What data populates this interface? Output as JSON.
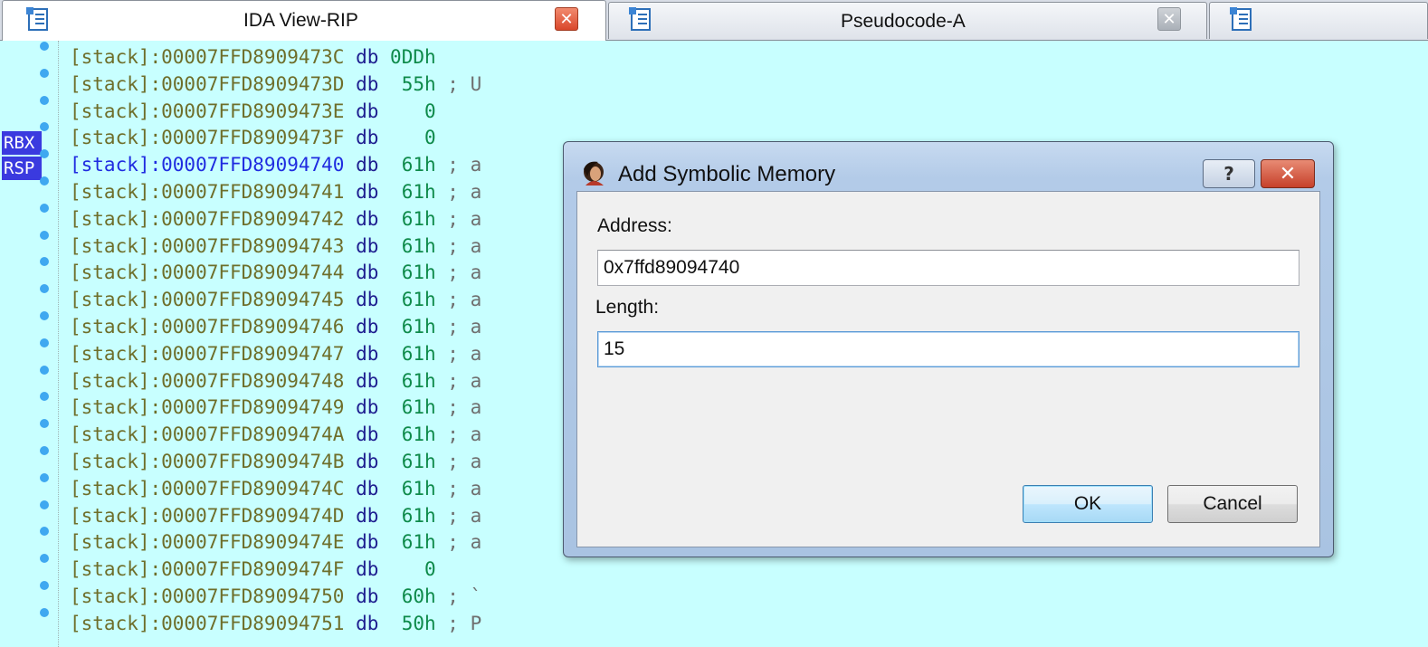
{
  "tabs": [
    {
      "label": "IDA View-RIP",
      "icon": "disassembly-view-icon",
      "active": true,
      "close_color": "red"
    },
    {
      "label": "Pseudocode-A",
      "icon": "pseudocode-view-icon",
      "active": false,
      "close_color": "grey"
    },
    {
      "label": "",
      "icon": "view-icon",
      "active": false
    }
  ],
  "registers": [
    "RBX",
    "RSP"
  ],
  "listing": [
    {
      "seg": "[stack]:00007FFD8909473C",
      "mn": "db",
      "val": "0DDh",
      "cmt": ""
    },
    {
      "seg": "[stack]:00007FFD8909473D",
      "mn": "db",
      "val": " 55h",
      "cmt": "; U"
    },
    {
      "seg": "[stack]:00007FFD8909473E",
      "mn": "db",
      "val": "   0",
      "cmt": ""
    },
    {
      "seg": "[stack]:00007FFD8909473F",
      "mn": "db",
      "val": "   0",
      "cmt": ""
    },
    {
      "seg": "[stack]:00007FFD89094740",
      "mn": "db",
      "val": " 61h",
      "cmt": "; a"
    },
    {
      "seg": "[stack]:00007FFD89094741",
      "mn": "db",
      "val": " 61h",
      "cmt": "; a"
    },
    {
      "seg": "[stack]:00007FFD89094742",
      "mn": "db",
      "val": " 61h",
      "cmt": "; a"
    },
    {
      "seg": "[stack]:00007FFD89094743",
      "mn": "db",
      "val": " 61h",
      "cmt": "; a"
    },
    {
      "seg": "[stack]:00007FFD89094744",
      "mn": "db",
      "val": " 61h",
      "cmt": "; a"
    },
    {
      "seg": "[stack]:00007FFD89094745",
      "mn": "db",
      "val": " 61h",
      "cmt": "; a"
    },
    {
      "seg": "[stack]:00007FFD89094746",
      "mn": "db",
      "val": " 61h",
      "cmt": "; a"
    },
    {
      "seg": "[stack]:00007FFD89094747",
      "mn": "db",
      "val": " 61h",
      "cmt": "; a"
    },
    {
      "seg": "[stack]:00007FFD89094748",
      "mn": "db",
      "val": " 61h",
      "cmt": "; a"
    },
    {
      "seg": "[stack]:00007FFD89094749",
      "mn": "db",
      "val": " 61h",
      "cmt": "; a"
    },
    {
      "seg": "[stack]:00007FFD8909474A",
      "mn": "db",
      "val": " 61h",
      "cmt": "; a"
    },
    {
      "seg": "[stack]:00007FFD8909474B",
      "mn": "db",
      "val": " 61h",
      "cmt": "; a"
    },
    {
      "seg": "[stack]:00007FFD8909474C",
      "mn": "db",
      "val": " 61h",
      "cmt": "; a"
    },
    {
      "seg": "[stack]:00007FFD8909474D",
      "mn": "db",
      "val": " 61h",
      "cmt": "; a"
    },
    {
      "seg": "[stack]:00007FFD8909474E",
      "mn": "db",
      "val": " 61h",
      "cmt": "; a"
    },
    {
      "seg": "[stack]:00007FFD8909474F",
      "mn": "db",
      "val": "   0",
      "cmt": ""
    },
    {
      "seg": "[stack]:00007FFD89094750",
      "mn": "db",
      "val": " 60h",
      "cmt": "; `"
    },
    {
      "seg": "[stack]:00007FFD89094751",
      "mn": "db",
      "val": " 50h",
      "cmt": "; P"
    }
  ],
  "dialog": {
    "title": "Add Symbolic Memory",
    "help_label": "?",
    "close_label": "✕",
    "address_label": "Address:",
    "address_value": "0x7ffd89094740",
    "length_label": "Length:",
    "length_value": "15",
    "ok_label": "OK",
    "cancel_label": "Cancel"
  },
  "colors": {
    "view_background": "#c8ffff",
    "register_badge": "#3a3adf",
    "breakpoint_dot": "#3fa8f0",
    "current_line_address": "#1f2be0"
  }
}
